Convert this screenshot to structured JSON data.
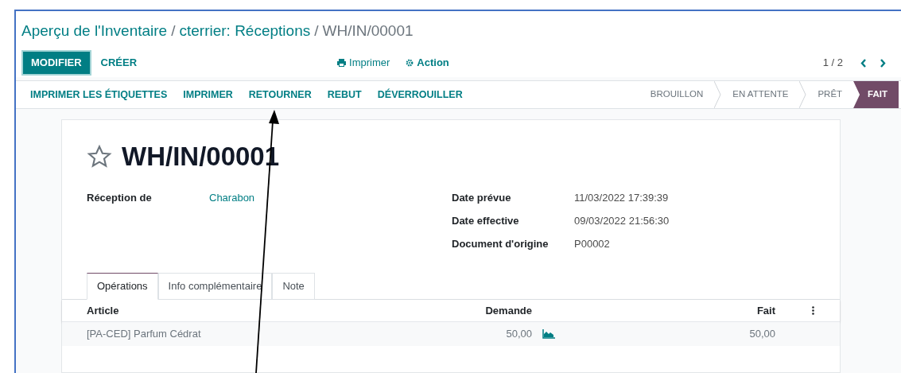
{
  "breadcrumb": {
    "separator": "/",
    "items": [
      {
        "label": "Aperçu de l'Inventaire",
        "current": false
      },
      {
        "label": "cterrier: Réceptions",
        "current": false
      },
      {
        "label": "WH/IN/00001",
        "current": true
      }
    ]
  },
  "control_panel": {
    "primary_button": "MODIFIER",
    "secondary_button": "CRÉER",
    "print_menu": "Imprimer",
    "action_menu": "Action",
    "pager": "1 / 2"
  },
  "header_buttons": [
    "IMPRIMER LES ÉTIQUETTES",
    "IMPRIMER",
    "RETOURNER",
    "REBUT",
    "DÉVERROUILLER"
  ],
  "stages": [
    {
      "label": "BROUILLON",
      "selected": false
    },
    {
      "label": "EN ATTENTE",
      "selected": false
    },
    {
      "label": "PRÊT",
      "selected": false
    },
    {
      "label": "FAIT",
      "selected": true
    }
  ],
  "record": {
    "title": "WH/IN/00001",
    "favorite": false,
    "left_fields": [
      {
        "label": "Réception de",
        "value": "Charabon",
        "link": true
      }
    ],
    "right_fields": [
      {
        "label": "Date prévue",
        "value": "11/03/2022 17:39:39",
        "link": false
      },
      {
        "label": "Date effective",
        "value": "09/03/2022 21:56:30",
        "link": false
      },
      {
        "label": "Document d'origine",
        "value": "P00002",
        "link": false
      }
    ]
  },
  "tabs": [
    {
      "label": "Opérations",
      "selected": true
    },
    {
      "label": "Info complémentaire",
      "selected": false
    },
    {
      "label": "Note",
      "selected": false
    }
  ],
  "table": {
    "columns": [
      "Article",
      "Demande",
      "Fait"
    ],
    "rows": [
      {
        "article": "[PA-CED] Parfum Cédrat",
        "demande": "50,00",
        "fait": "50,00"
      }
    ]
  }
}
